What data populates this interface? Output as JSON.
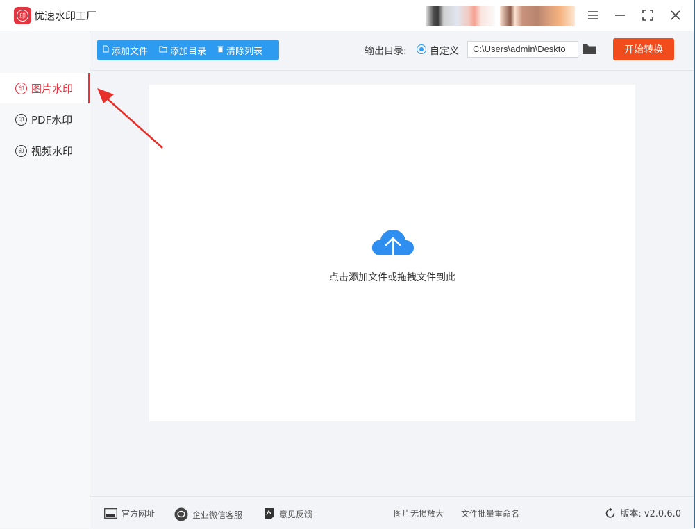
{
  "app": {
    "title": "优速水印工厂",
    "logo_text": "印"
  },
  "sidebar": {
    "items": [
      {
        "label": "图片水印",
        "active": true
      },
      {
        "label": "PDF水印",
        "active": false
      },
      {
        "label": "视频水印",
        "active": false
      }
    ]
  },
  "toolbar": {
    "add_file": "添加文件",
    "add_dir": "添加目录",
    "clear_list": "清除列表",
    "output_label": "输出目录:",
    "custom_option": "自定义",
    "output_path": "C:\\Users\\admin\\Deskto",
    "start_button": "开始转换"
  },
  "droparea": {
    "hint": "点击添加文件或拖拽文件到此"
  },
  "footer": {
    "website": "官方网址",
    "wechat": "企业微信客服",
    "feedback": "意见反馈",
    "image_enlarge": "图片无损放大",
    "batch_rename": "文件批量重命名",
    "version": "版本: v2.0.6.0"
  },
  "colors": {
    "accent": "#e5343f",
    "primary": "#2c9bf0",
    "start": "#f04c1c"
  }
}
